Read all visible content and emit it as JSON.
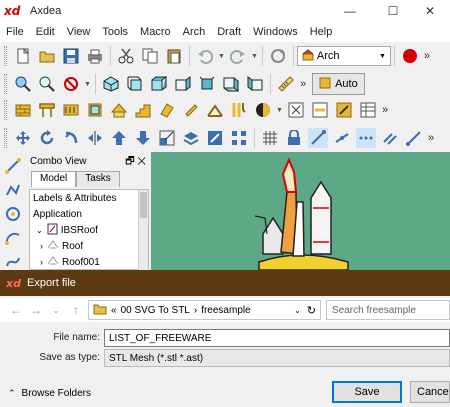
{
  "app": {
    "logo": "xd",
    "title": "Axdea",
    "controls": {
      "minimize": "—",
      "maximize": "☐",
      "close": "✕"
    }
  },
  "menu": [
    "File",
    "Edit",
    "View",
    "Tools",
    "Macro",
    "Arch",
    "Draft",
    "Windows",
    "Help"
  ],
  "toolbar": {
    "workbench": "Arch",
    "auto_label": "Auto",
    "more": "»"
  },
  "combo_view": {
    "title": "Combo View",
    "controls": "🗗 ✕",
    "tabs": [
      "Model",
      "Tasks"
    ],
    "tree": [
      {
        "label": "Labels & Attributes",
        "indent": 0
      },
      {
        "label": "Application",
        "indent": 0
      },
      {
        "label": "IBSRoof",
        "indent": 1
      },
      {
        "label": "Roof",
        "indent": 2
      },
      {
        "label": "Roof001",
        "indent": 2
      }
    ]
  },
  "dialog": {
    "logo": "xd",
    "title": "Export file",
    "breadcrumb": [
      "«",
      "00 SVG To STL",
      "›",
      "freesample"
    ],
    "search_placeholder": "Search freesample",
    "file_name_label": "File name:",
    "file_name_value": "LIST_OF_FREEWARE",
    "save_type_label": "Save as type:",
    "save_type_value": "STL Mesh (*.stl *.ast)",
    "browse_label": "Browse Folders",
    "save_label": "Save",
    "cancel_label": "Cancel"
  },
  "colors": {
    "viewport": "#5da886",
    "dialog_title": "#5d3a12",
    "accent": "#0078d7"
  }
}
